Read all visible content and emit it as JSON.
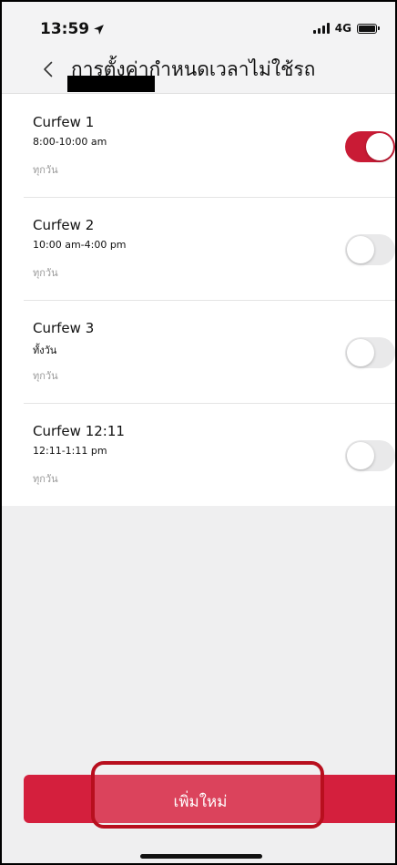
{
  "status_bar": {
    "time": "13:59",
    "network": "4G"
  },
  "header": {
    "back_icon": "chevron-left-icon",
    "title": "การตั้งค่ากำหนดเวลาไม่ใช้รถ"
  },
  "curfews": [
    {
      "name": "Curfew 1",
      "time": "8:00-10:00 am",
      "days": "ทุกวัน",
      "enabled": true
    },
    {
      "name": "Curfew 2",
      "time": "10:00 am-4:00 pm",
      "days": "ทุกวัน",
      "enabled": false
    },
    {
      "name": "Curfew 3",
      "time": "ทั้งวัน",
      "days": "ทุกวัน",
      "enabled": false
    },
    {
      "name": "Curfew 12:11",
      "time": "12:11-1:11 pm",
      "days": "ทุกวัน",
      "enabled": false
    }
  ],
  "add_button": {
    "label": "เพิ่มใหม่"
  },
  "colors": {
    "accent": "#c91b35",
    "button": "#d41f3d",
    "highlight": "#b80f1e",
    "toggle_off": "#e9e9ea"
  }
}
